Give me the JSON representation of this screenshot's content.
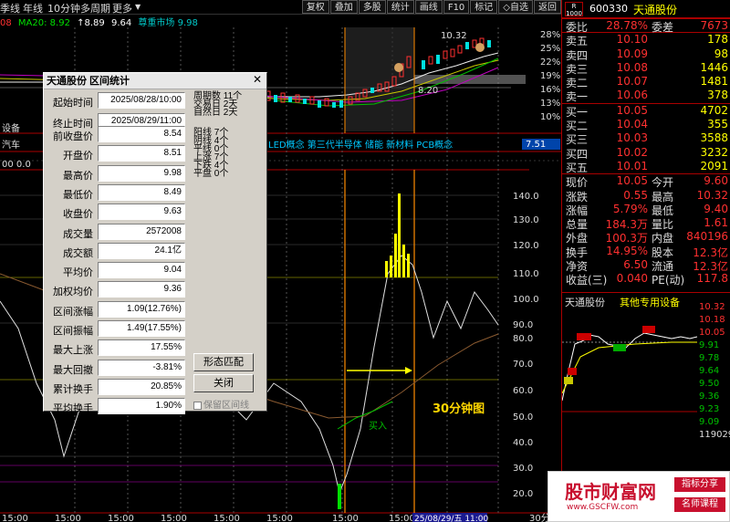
{
  "toolbar": {
    "left": [
      "季线",
      "年线",
      "10分钟",
      "多周期",
      "更多"
    ],
    "right": [
      "复权",
      "叠加",
      "多股",
      "统计",
      "画线",
      "F10",
      "标记",
      "◇自选",
      "返回"
    ]
  },
  "maline": {
    "ma1": "08",
    "ma20": "MA20: 8.92",
    "a": "↑8.89",
    "b": "9.64",
    "c": "尊重市场 9.98"
  },
  "chart": {
    "pct_labels": [
      "28%",
      "25%",
      "22%",
      "19%",
      "16%",
      "13%",
      "10%"
    ],
    "vol_labels": [
      "140.0",
      "130.0",
      "120.0",
      "110.0",
      "100.0",
      "90.0",
      "80.0",
      "70.0",
      "60.0",
      "50.0",
      "40.0",
      "30.0",
      "20.0"
    ],
    "price_hi": "10.32",
    "price_lo": "8.20",
    "left_text1": "设备",
    "concept_line": "LED概念 第三代半导体 储能 新材料 PCB概念",
    "concept_left": "汽车",
    "concept_value": "7.51",
    "zero_label": "00  0.0",
    "buy_label": "买入",
    "chart_note": "30分钟图",
    "time_labels": [
      "15:00",
      "15:00",
      "15:00",
      "15:00",
      "15:00",
      "15:00",
      "15:00",
      "15:00",
      "15:00",
      "15:00"
    ],
    "time_box": "25/08/29/五 11:00",
    "period": "30分钟"
  },
  "dialog": {
    "title": "天通股份 区间统计",
    "fields": [
      {
        "label": "起始时间",
        "value": "2025/08/28/10:00"
      },
      {
        "label": "终止时间",
        "value": "2025/08/29/11:00"
      },
      {
        "label": "前收盘价",
        "value": "8.54"
      },
      {
        "label": "开盘价",
        "value": "8.51"
      },
      {
        "label": "最高价",
        "value": "9.98"
      },
      {
        "label": "最低价",
        "value": "8.49"
      },
      {
        "label": "收盘价",
        "value": "9.63"
      },
      {
        "label": "成交量",
        "value": "2572008"
      },
      {
        "label": "成交额",
        "value": "24.1亿"
      },
      {
        "label": "平均价",
        "value": "9.04"
      },
      {
        "label": "加权均价",
        "value": "9.36"
      },
      {
        "label": "区间涨幅",
        "value": "1.09(12.76%)"
      },
      {
        "label": "区间振幅",
        "value": "1.49(17.55%)"
      },
      {
        "label": "最大上涨",
        "value": "17.55%"
      },
      {
        "label": "最大回撤",
        "value": "-3.81%"
      },
      {
        "label": "累计换手",
        "value": "20.85%"
      },
      {
        "label": "平均换手",
        "value": "1.90%"
      }
    ],
    "stats1": [
      "周期数 11个",
      "交易日 2天",
      "自然日 2天"
    ],
    "stats2": [
      "阳线 7个",
      "阴线 4个",
      "平线 0个",
      "上涨 7个",
      "下跌 4个",
      "平盘 0个"
    ],
    "btn_pattern": "形态匹配",
    "btn_close": "关闭",
    "keep_label": "保留区间线"
  },
  "quote": {
    "code": "600330",
    "name": "天通股份",
    "rbox": "R 1000",
    "webi_label": "委比",
    "webi_value": "28.78%",
    "weicha_label": "委差",
    "weicha_value": "7673",
    "sells": [
      {
        "label": "卖五",
        "price": "10.10",
        "vol": "178"
      },
      {
        "label": "卖四",
        "price": "10.09",
        "vol": "98"
      },
      {
        "label": "卖三",
        "price": "10.08",
        "vol": "1446"
      },
      {
        "label": "卖二",
        "price": "10.07",
        "vol": "1481"
      },
      {
        "label": "卖一",
        "price": "10.06",
        "vol": "378"
      }
    ],
    "buys": [
      {
        "label": "买一",
        "price": "10.05",
        "vol": "4702"
      },
      {
        "label": "买二",
        "price": "10.04",
        "vol": "355"
      },
      {
        "label": "买三",
        "price": "10.03",
        "vol": "3588"
      },
      {
        "label": "买四",
        "price": "10.02",
        "vol": "3232"
      },
      {
        "label": "买五",
        "price": "10.01",
        "vol": "2091"
      }
    ],
    "stats": [
      {
        "l1": "现价",
        "v1": "10.05",
        "l2": "今开",
        "v2": "9.60"
      },
      {
        "l1": "涨跌",
        "v1": "0.55",
        "l2": "最高",
        "v2": "10.32"
      },
      {
        "l1": "涨幅",
        "v1": "5.79%",
        "l2": "最低",
        "v2": "9.40"
      },
      {
        "l1": "总量",
        "v1": "184.3万",
        "l2": "量比",
        "v2": "1.61"
      },
      {
        "l1": "外盘",
        "v1": "100.3万",
        "l2": "内盘",
        "v2": "840196"
      },
      {
        "l1": "换手",
        "v1": "14.95%",
        "l2": "股本",
        "v2": "12.3亿"
      },
      {
        "l1": "净资",
        "v1": "6.50",
        "l2": "流通",
        "v2": "12.3亿"
      },
      {
        "l1": "收益(三)",
        "v1": "0.040",
        "l2": "PE(动)",
        "v2": "117.8"
      }
    ],
    "mini_title": "天通股份",
    "mini_sub": "其他专用设备",
    "mini_prices": [
      "10.32",
      "10.18",
      "10.05",
      "9.91",
      "9.78",
      "9.64",
      "9.50",
      "9.36",
      "9.23",
      "9.09",
      "119029"
    ],
    "mini_tags": [
      "调整",
      "冲高",
      "强势",
      "调整",
      "再攻"
    ]
  },
  "watermark": {
    "big": "股市财富网",
    "url": "www.GSCFW.com",
    "tag1": "指标分享",
    "tag2": "名师课程"
  }
}
